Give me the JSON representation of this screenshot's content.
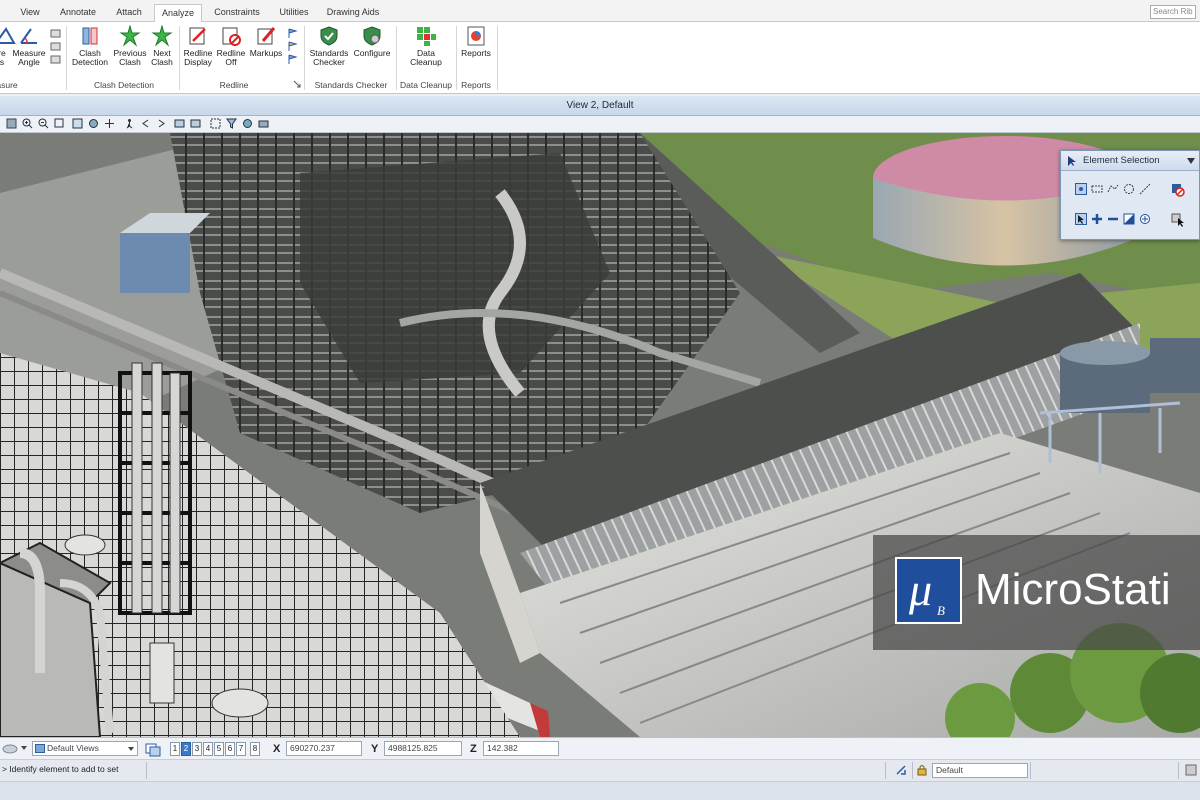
{
  "ribbon": {
    "tabs": [
      {
        "label": "View"
      },
      {
        "label": "Annotate"
      },
      {
        "label": "Attach"
      },
      {
        "label": "Analyze"
      },
      {
        "label": "Constraints"
      },
      {
        "label": "Utilities"
      },
      {
        "label": "Drawing Aids"
      }
    ],
    "active_tab": "Analyze",
    "search_placeholder": "Search Rib",
    "buttons": {
      "measure_partial_1": "re",
      "measure_partial_2": "s",
      "measure_angle_1": "Measure",
      "measure_angle_2": "Angle",
      "clash_detection_1": "Clash",
      "clash_detection_2": "Detection",
      "previous_clash_1": "Previous",
      "previous_clash_2": "Clash",
      "next_clash_1": "Next",
      "next_clash_2": "Clash",
      "redline_display_1": "Redline",
      "redline_display_2": "Display",
      "redline_off_1": "Redline",
      "redline_off_2": "Off",
      "markups": "Markups",
      "standards_checker_1": "Standards",
      "standards_checker_2": "Checker",
      "configure": "Configure",
      "data_cleanup_1": "Data",
      "data_cleanup_2": "Cleanup",
      "reports": "Reports"
    },
    "groups": {
      "measure": "asure",
      "clash_detection": "Clash Detection",
      "redline": "Redline",
      "standards_checker": "Standards Checker",
      "data_cleanup": "Data Cleanup",
      "reports": "Reports"
    }
  },
  "view": {
    "title": "View 2, Default"
  },
  "element_selection": {
    "title": "Element Selection"
  },
  "watermark": {
    "brand": "MicroStati"
  },
  "statusbar": {
    "views_dropdown": "Default Views",
    "view_numbers": [
      "1",
      "2",
      "3",
      "4",
      "5",
      "6",
      "7",
      "8"
    ],
    "active_view": "2",
    "x_label": "X",
    "x_value": "690270.237",
    "y_label": "Y",
    "y_value": "4988125.825",
    "z_label": "Z",
    "z_value": "142.382",
    "prompt": "> Identify element to add to set",
    "level": "Default"
  },
  "colors": {
    "ribbon_bg": "#ffffff",
    "title_bar": "#c8d7ea",
    "accent": "#3a78c9",
    "watermark_logo": "#1f4f9c"
  }
}
